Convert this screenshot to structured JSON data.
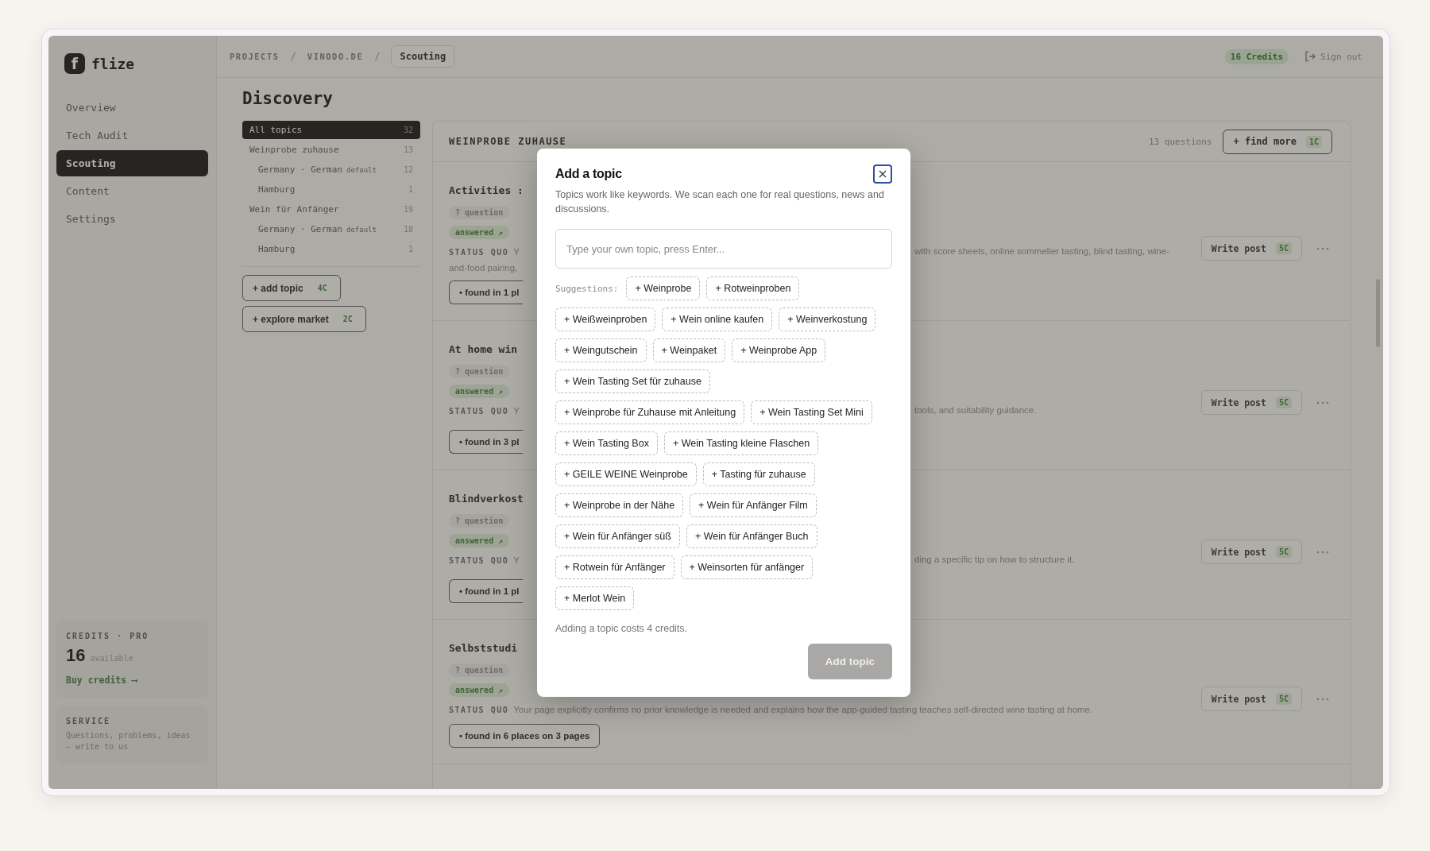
{
  "logo": {
    "mark": "f",
    "name": "flize"
  },
  "nav": [
    {
      "label": "Overview",
      "selected": false
    },
    {
      "label": "Tech Audit",
      "selected": false
    },
    {
      "label": "Scouting",
      "selected": true
    },
    {
      "label": "Content",
      "selected": false
    },
    {
      "label": "Settings",
      "selected": false
    }
  ],
  "credits_card": {
    "heading": "CREDITS · PRO",
    "amount": "16",
    "unit": "available",
    "link": "Buy credits ⟶"
  },
  "service_card": {
    "heading": "SERVICE",
    "text": "Questions, problems, ideas — write to us"
  },
  "breadcrumb": [
    {
      "kind": "crumb",
      "text": "PROJECTS"
    },
    {
      "kind": "sep",
      "text": "/"
    },
    {
      "kind": "crumb",
      "text": "VINODO.DE"
    },
    {
      "kind": "sep",
      "text": "/"
    },
    {
      "kind": "current",
      "text": "Scouting"
    }
  ],
  "topbar": {
    "credits": "16 Credits",
    "sign_out": "Sign out"
  },
  "page_title": "Discovery",
  "topics": [
    {
      "label": "All topics",
      "count": "32",
      "selected": true
    },
    {
      "label": "Weinprobe zuhause",
      "count": "13",
      "selected": false,
      "children": [
        {
          "label": "Germany · German",
          "tag": "default",
          "count": "12",
          "selected": false
        },
        {
          "label": "Hamburg",
          "count": "1",
          "selected": false
        }
      ]
    },
    {
      "label": "Wein für Anfänger",
      "count": "19",
      "selected": false,
      "children": [
        {
          "label": "Germany · German",
          "tag": "default",
          "count": "18",
          "selected": false
        },
        {
          "label": "Hamburg",
          "count": "1",
          "selected": false
        }
      ]
    }
  ],
  "topic_actions": [
    {
      "label": "+ add topic",
      "cost": "4C"
    },
    {
      "label": "+ explore market",
      "cost": "2C"
    }
  ],
  "panel": {
    "title": "WEINPROBE ZUHAUSE",
    "count": "13 questions",
    "find_more": "+ find more",
    "find_cost": "1C"
  },
  "rows": [
    {
      "kind": "covered",
      "title": "Activities :",
      "tags": [
        {
          "kind": "question",
          "label": "? question"
        },
        {
          "kind": "answered",
          "label": "answered ↗"
        }
      ],
      "status_label": "STATUS QUO",
      "status_left": "Y",
      "status_left_2": "and-food pairing,",
      "status_right": "with score sheets, online sommelier tasting, blind tasting, wine-",
      "found": "• found in 1 pl",
      "write": "Write post",
      "write_cost": "5C"
    },
    {
      "kind": "covered",
      "title": "At home win",
      "tags": [
        {
          "kind": "question",
          "label": "? question"
        },
        {
          "kind": "answered",
          "label": "answered ↗"
        }
      ],
      "status_label": "STATUS QUO",
      "status_left": "Y",
      "status_right": "tools, and suitability guidance.",
      "found": "• found in 3 pl",
      "write": "Write post",
      "write_cost": "5C"
    },
    {
      "kind": "covered",
      "title": "Blindverkost",
      "tags": [
        {
          "kind": "question",
          "label": "? question"
        },
        {
          "kind": "answered",
          "label": "answered ↗"
        }
      ],
      "status_label": "STATUS QUO",
      "status_left": "Y",
      "status_right": "ding a specific tip on how to structure it.",
      "found": "• found in 1 pl",
      "write": "Write post",
      "write_cost": "5C"
    },
    {
      "kind": "full",
      "title": "Selbststudi",
      "tags": [
        {
          "kind": "question",
          "label": "? question"
        },
        {
          "kind": "answered",
          "label": "answered ↗"
        }
      ],
      "status_label": "STATUS QUO",
      "status_text": "Your page explicitly confirms no prior knowledge is needed and explains how the app-guided tasting teaches self-directed wine tasting at home.",
      "found": "• found in 6 places on 3 pages",
      "write": "Write post",
      "write_cost": "5C"
    }
  ],
  "dialog": {
    "title": "Add a topic",
    "description": "Topics work like keywords. We scan each one for real questions, news and discussions.",
    "input": {
      "placeholder": "Type your own topic, press Enter..."
    },
    "suggestions_label": "Suggestions:",
    "suggestions": [
      "+ Weinprobe",
      "+ Rotweinproben",
      "+ Weißweinproben",
      "+ Wein online kaufen",
      "+ Weinverkostung",
      "+ Weingutschein",
      "+ Weinpaket",
      "+ Weinprobe App",
      "+ Wein Tasting Set für zuhause",
      "+ Weinprobe für Zuhause mit Anleitung",
      "+ Wein Tasting Set Mini",
      "+ Wein Tasting Box",
      "+ Wein Tasting kleine Flaschen",
      "+ GEILE WEINE Weinprobe",
      "+ Tasting für zuhause",
      "+ Weinprobe in der Nähe",
      "+ Wein für Anfänger Film",
      "+ Wein für Anfänger süß",
      "+ Wein für Anfänger Buch",
      "+ Rotwein für Anfänger",
      "+ Weinsorten für anfänger",
      "+ Merlot Wein"
    ],
    "note": "Adding a topic costs 4 credits.",
    "submit": {
      "label": "Add topic",
      "disabled": true
    }
  }
}
